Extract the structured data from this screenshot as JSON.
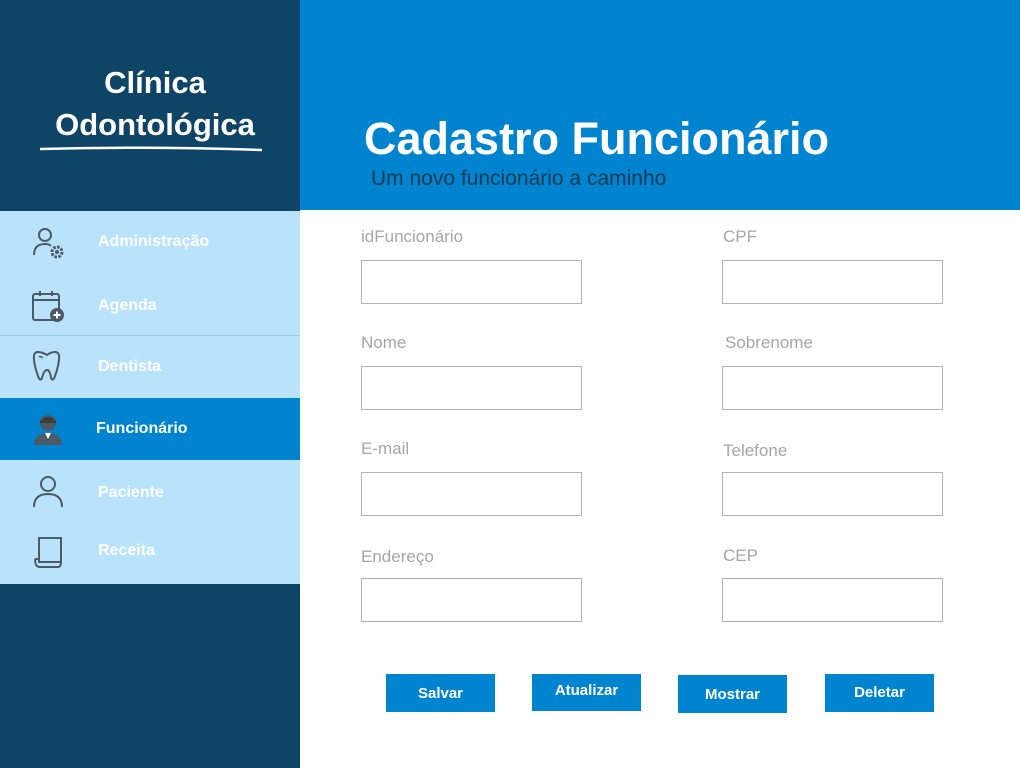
{
  "brand": {
    "line1": "Clínica",
    "line2": "Odontológica"
  },
  "header": {
    "title": "Cadastro Funcionário",
    "subtitle": "Um novo funcionário a caminho"
  },
  "sidebar": {
    "items": [
      {
        "label": "Administração",
        "icon": "user-gear-icon"
      },
      {
        "label": "Agenda",
        "icon": "calendar-add-icon"
      },
      {
        "label": "Dentista",
        "icon": "tooth-icon"
      },
      {
        "label": "Funcionário",
        "icon": "employee-icon",
        "active": true
      },
      {
        "label": "Paciente",
        "icon": "user-icon"
      },
      {
        "label": "Receita",
        "icon": "prescription-icon"
      }
    ]
  },
  "form": {
    "fields": [
      {
        "label": "idFuncionário",
        "value": ""
      },
      {
        "label": "CPF",
        "value": ""
      },
      {
        "label": "Nome",
        "value": ""
      },
      {
        "label": "Sobrenome",
        "value": ""
      },
      {
        "label": "E-mail",
        "value": ""
      },
      {
        "label": "Telefone",
        "value": ""
      },
      {
        "label": "Endereço",
        "value": ""
      },
      {
        "label": "CEP",
        "value": ""
      }
    ]
  },
  "buttons": {
    "save": "Salvar",
    "update": "Atualizar",
    "show": "Mostrar",
    "delete": "Deletar"
  },
  "colors": {
    "sidebar_bg": "#0e4466",
    "nav_bg": "#b9e3fb",
    "accent": "#0184d0",
    "field_border": "#b3b3b3",
    "label_gray": "#a6a6a6"
  }
}
